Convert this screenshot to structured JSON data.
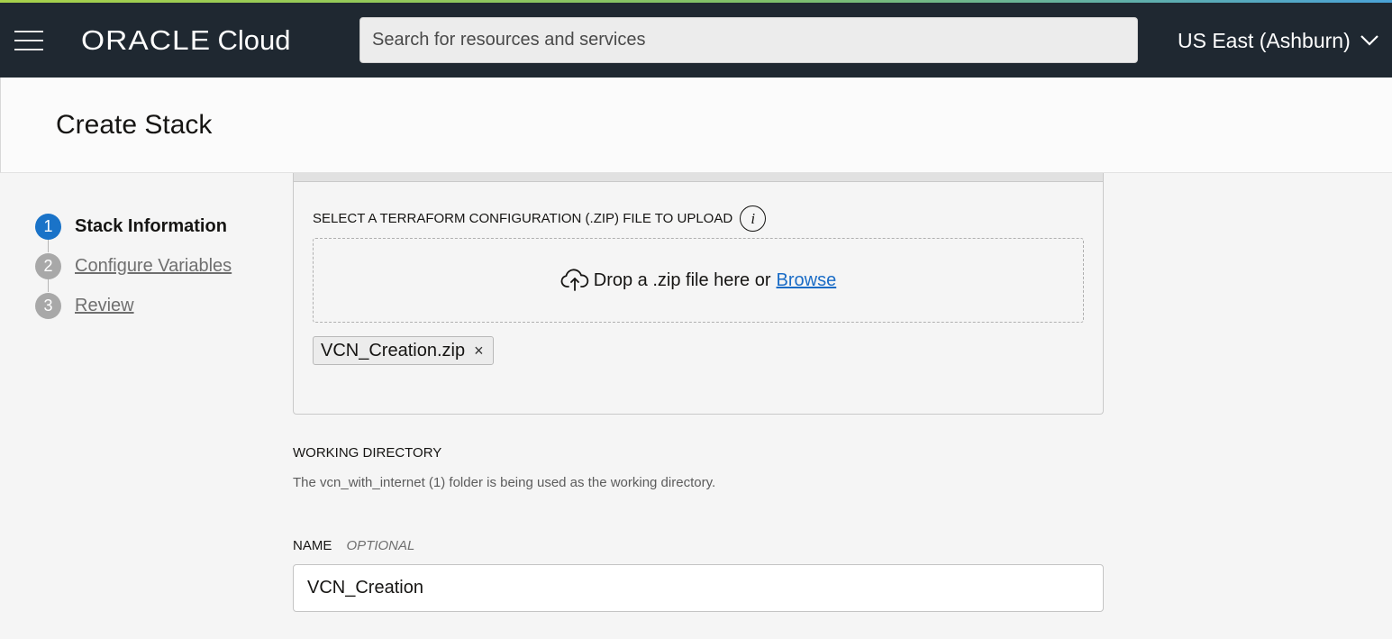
{
  "header": {
    "logo_brand": "ORACLE",
    "logo_product": "Cloud",
    "search_placeholder": "Search for resources and services",
    "region": "US East (Ashburn)"
  },
  "page": {
    "title": "Create Stack"
  },
  "steps": [
    {
      "number": "1",
      "label": "Stack Information",
      "state": "active"
    },
    {
      "number": "2",
      "label": "Configure Variables",
      "state": "inactive"
    },
    {
      "number": "3",
      "label": "Review",
      "state": "inactive"
    }
  ],
  "upload": {
    "label": "SELECT A TERRAFORM CONFIGURATION (.ZIP) FILE TO UPLOAD",
    "info_icon_glyph": "i",
    "drop_text": "Drop a .zip file here or",
    "browse_label": "Browse",
    "file_name": "VCN_Creation.zip",
    "remove_glyph": "×"
  },
  "working_directory": {
    "label": "WORKING DIRECTORY",
    "description": "The vcn_with_internet (1) folder is being used as the working directory."
  },
  "name_field": {
    "label": "NAME",
    "optional": "OPTIONAL",
    "value": "VCN_Creation"
  },
  "colors": {
    "header_bg": "#1f2831",
    "accent_blue": "#1a73c8",
    "link_blue": "#1a6cc6",
    "inactive_step": "#a8a8a8"
  },
  "icons": [
    "menu-icon",
    "chevron-down-icon",
    "info-icon",
    "cloud-upload-icon",
    "close-icon"
  ]
}
